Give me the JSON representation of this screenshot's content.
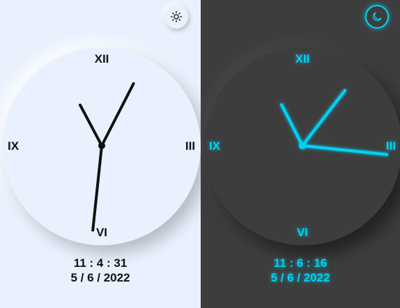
{
  "light": {
    "mode_icon": "sun-icon",
    "numerals": {
      "top": "XII",
      "right": "III",
      "bottom": "VI",
      "left": "IX"
    },
    "time": "11 : 4 : 31",
    "date": "5 / 6 / 2022",
    "clock": {
      "hour": 11,
      "minute": 4,
      "second": 31
    },
    "hand_color": "#111111"
  },
  "dark": {
    "mode_icon": "moon-icon",
    "numerals": {
      "top": "XII",
      "right": "III",
      "bottom": "VI",
      "left": "IX"
    },
    "time": "11 : 6 : 16",
    "date": "5 / 6 / 2022",
    "clock": {
      "hour": 11,
      "minute": 6,
      "second": 16
    },
    "hand_color": "#00d1f5"
  }
}
